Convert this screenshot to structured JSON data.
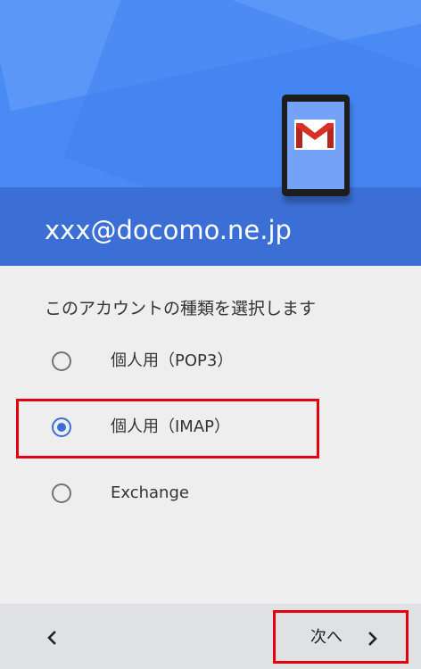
{
  "header": {
    "email": "xxx@docomo.ne.jp",
    "colors": {
      "header_blue": "#4a8af4",
      "band_blue": "#3b6fd6"
    },
    "illustration_icon": "gmail-tablet-icon"
  },
  "main": {
    "prompt": "このアカウントの種類を選択します",
    "options": [
      {
        "label": "個人用（POP3）",
        "selected": false
      },
      {
        "label": "個人用（IMAP）",
        "selected": true
      },
      {
        "label": "Exchange",
        "selected": false
      }
    ]
  },
  "footer": {
    "back_icon": "chevron-left-icon",
    "next_label": "次へ",
    "next_icon": "chevron-right-icon"
  },
  "annotation": {
    "highlight_color": "#e3000f"
  }
}
